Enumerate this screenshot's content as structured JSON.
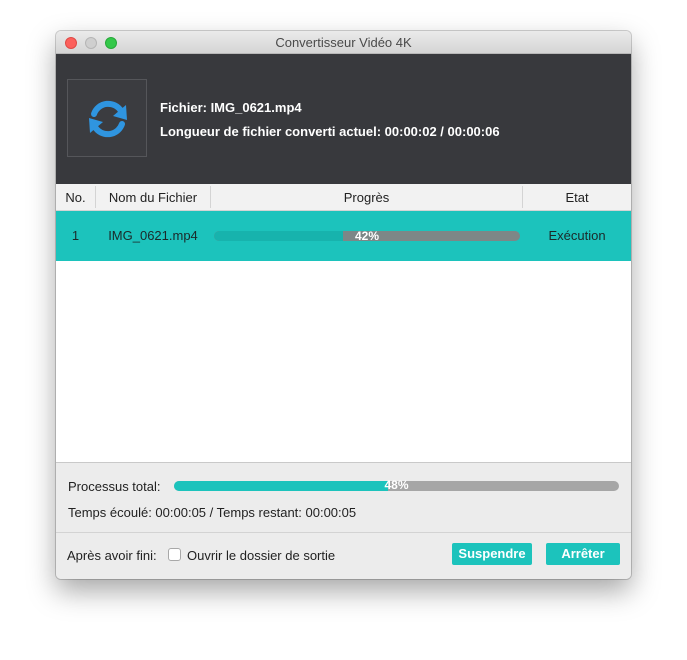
{
  "window": {
    "title": "Convertisseur Vidéo 4K"
  },
  "header": {
    "file_line": "Fichier: IMG_0621.mp4",
    "length_line": "Longueur de fichier converti actuel: 00:00:02 / 00:00:06",
    "icon": "refresh-icon",
    "icon_color": "#2f95e0"
  },
  "table": {
    "columns": [
      "No.",
      "Nom du Fichier",
      "Progrès",
      "Etat"
    ],
    "rows": [
      {
        "no": "1",
        "name": "IMG_0621.mp4",
        "progress": 42,
        "progress_label": "42%",
        "state": "Exécution"
      }
    ]
  },
  "total": {
    "label": "Processus total:",
    "progress": 48,
    "progress_label": "48%",
    "time_line": "Temps écoulé: 00:00:05 / Temps restant: 00:00:05"
  },
  "footer": {
    "after_label": "Après avoir fini:",
    "open_folder_label": "Ouvrir le dossier de sortie",
    "open_folder_checked": false,
    "suspend_label": "Suspendre",
    "stop_label": "Arrêter"
  },
  "colors": {
    "accent": "#1cc3bc",
    "header_bg": "#38393d"
  }
}
